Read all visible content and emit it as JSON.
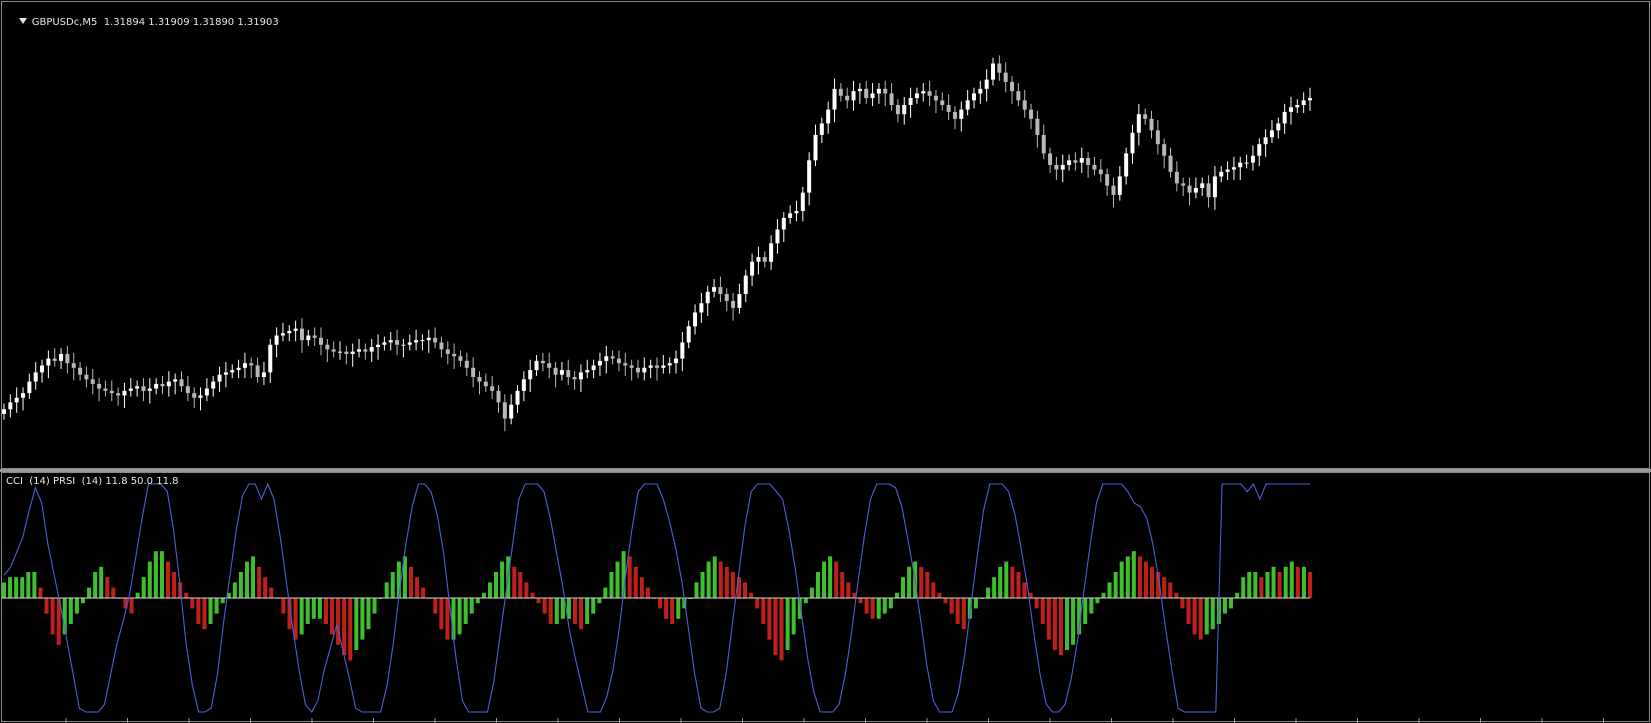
{
  "header": {
    "symbol_line": "GBPUSDc,M5  1.31894 1.31909 1.31890 1.31903",
    "indicator_line": "CCI  (14) PRSI  (14) 11.8 50.0 11.8"
  },
  "colors": {
    "background": "#000000",
    "bull_candle": "#ffffff",
    "bear_candle": "#b8b8b8",
    "cci_line": "#4d5fd6",
    "hist_up": "#3fbf2f",
    "hist_down": "#c0201a",
    "zero_line": "#d8d8d8"
  },
  "chart_data": [
    {
      "type": "candlestick",
      "title": "GBPUSDc,M5",
      "last_bar": {
        "open": 1.31894,
        "high": 1.31909,
        "low": 1.3189,
        "close": 1.31903
      },
      "ylim": [
        1.306,
        1.325
      ],
      "close_series": [
        1.3082,
        1.3085,
        1.3087,
        1.3089,
        1.3094,
        1.3098,
        1.3101,
        1.3104,
        1.3103,
        1.3106,
        1.3102,
        1.31,
        1.3097,
        1.3095,
        1.3093,
        1.3091,
        1.309,
        1.3089,
        1.3088,
        1.309,
        1.3091,
        1.3092,
        1.309,
        1.3091,
        1.3093,
        1.3092,
        1.3094,
        1.3095,
        1.3092,
        1.3089,
        1.3087,
        1.3088,
        1.3091,
        1.3094,
        1.3097,
        1.3098,
        1.3099,
        1.31,
        1.3102,
        1.3101,
        1.3096,
        1.3098,
        1.311,
        1.3114,
        1.3115,
        1.3116,
        1.3117,
        1.3112,
        1.3114,
        1.3113,
        1.311,
        1.3108,
        1.3107,
        1.3107,
        1.3106,
        1.3107,
        1.3108,
        1.3107,
        1.3109,
        1.311,
        1.3111,
        1.3112,
        1.311,
        1.311,
        1.3111,
        1.3112,
        1.3112,
        1.3113,
        1.3111,
        1.3108,
        1.3106,
        1.3105,
        1.3103,
        1.31,
        1.3096,
        1.3094,
        1.3092,
        1.309,
        1.3085,
        1.3078,
        1.3084,
        1.309,
        1.3095,
        1.3099,
        1.3103,
        1.3102,
        1.31,
        1.3097,
        1.3099,
        1.3096,
        1.3095,
        1.3098,
        1.3099,
        1.3101,
        1.3103,
        1.3105,
        1.3104,
        1.3102,
        1.3101,
        1.31,
        1.3098,
        1.31,
        1.3101,
        1.31,
        1.3101,
        1.3102,
        1.3104,
        1.3111,
        1.3118,
        1.3124,
        1.3128,
        1.3133,
        1.3135,
        1.3132,
        1.3129,
        1.3126,
        1.3132,
        1.314,
        1.3146,
        1.3148,
        1.3146,
        1.3154,
        1.316,
        1.3165,
        1.3167,
        1.3168,
        1.3176,
        1.319,
        1.3201,
        1.3206,
        1.3212,
        1.3221,
        1.3218,
        1.3216,
        1.322,
        1.3221,
        1.3217,
        1.3219,
        1.3221,
        1.3219,
        1.3214,
        1.321,
        1.3214,
        1.3217,
        1.3219,
        1.322,
        1.3218,
        1.3216,
        1.3214,
        1.3211,
        1.3208,
        1.3212,
        1.3216,
        1.3219,
        1.3221,
        1.3225,
        1.3232,
        1.3228,
        1.3224,
        1.322,
        1.3216,
        1.3212,
        1.3208,
        1.3201,
        1.3193,
        1.3188,
        1.3186,
        1.3188,
        1.319,
        1.3189,
        1.3191,
        1.3188,
        1.3186,
        1.3184,
        1.3179,
        1.3175,
        1.3183,
        1.3193,
        1.3202,
        1.321,
        1.3208,
        1.3203,
        1.3197,
        1.3192,
        1.3185,
        1.318,
        1.3179,
        1.3176,
        1.3178,
        1.318,
        1.3174,
        1.3183,
        1.3185,
        1.3186,
        1.3187,
        1.3189,
        1.3189,
        1.3192,
        1.3197,
        1.32,
        1.3203,
        1.3206,
        1.3211,
        1.3213,
        1.3214,
        1.3216,
        1.3217
      ]
    },
    {
      "type": "line+histogram",
      "title": "CCI (14) PRSI (14)",
      "values_shown": [
        11.8,
        50.0,
        11.8
      ],
      "ylim": [
        -300,
        300
      ],
      "cci_series": [
        60,
        80,
        120,
        160,
        230,
        290,
        250,
        140,
        60,
        -20,
        -110,
        -200,
        -290,
        -300,
        -300,
        -300,
        -280,
        -200,
        -120,
        -60,
        10,
        110,
        210,
        300,
        300,
        300,
        280,
        180,
        40,
        -120,
        -230,
        -300,
        -300,
        -290,
        -200,
        -60,
        60,
        180,
        270,
        300,
        300,
        260,
        300,
        260,
        160,
        40,
        -80,
        -190,
        -280,
        -300,
        -270,
        -190,
        -130,
        -70,
        -140,
        -210,
        -290,
        -300,
        -300,
        -300,
        -300,
        -230,
        -120,
        20,
        140,
        240,
        300,
        300,
        280,
        220,
        120,
        -20,
        -160,
        -270,
        -300,
        -300,
        -300,
        -300,
        -220,
        -100,
        20,
        140,
        260,
        300,
        300,
        300,
        280,
        210,
        120,
        30,
        -80,
        -160,
        -230,
        -300,
        -300,
        -300,
        -260,
        -190,
        -80,
        60,
        180,
        280,
        300,
        300,
        300,
        260,
        200,
        130,
        40,
        -80,
        -200,
        -290,
        -300,
        -300,
        -290,
        -200,
        -70,
        60,
        190,
        280,
        300,
        300,
        300,
        280,
        260,
        180,
        80,
        -40,
        -160,
        -250,
        -300,
        -300,
        -300,
        -280,
        -200,
        -90,
        40,
        160,
        260,
        300,
        300,
        300,
        290,
        240,
        150,
        60,
        -60,
        -180,
        -270,
        -300,
        -300,
        -300,
        -250,
        -150,
        -20,
        110,
        230,
        300,
        300,
        300,
        280,
        220,
        130,
        30,
        -90,
        -200,
        -280,
        -300,
        -300,
        -280,
        -210,
        -110,
        20,
        140,
        250,
        300,
        300,
        300,
        300,
        280,
        250,
        240,
        210,
        140,
        40,
        -80,
        -190,
        -290,
        -300,
        -300,
        -300,
        -300,
        -300,
        -300,
        300,
        300,
        300,
        300,
        280,
        300,
        260,
        300,
        300,
        300,
        300,
        300,
        300,
        300,
        300
      ],
      "prsi_histogram": [
        3,
        4,
        4,
        4,
        5,
        5,
        2,
        -3,
        -7,
        -9,
        -7,
        -5,
        -3,
        -1,
        2,
        5,
        6,
        4,
        2,
        0,
        -2,
        -3,
        1,
        4,
        7,
        9,
        9,
        7,
        5,
        3,
        1,
        -2,
        -5,
        -6,
        -5,
        -3,
        -1,
        1,
        3,
        5,
        7,
        8,
        6,
        4,
        2,
        0,
        -3,
        -6,
        -8,
        -7,
        -5,
        -4,
        -4,
        -5,
        -7,
        -9,
        -11,
        -12,
        -10,
        -8,
        -6,
        -3,
        0,
        3,
        5,
        7,
        8,
        6,
        4,
        2,
        0,
        -3,
        -6,
        -8,
        -8,
        -7,
        -5,
        -3,
        -1,
        1,
        3,
        5,
        7,
        8,
        6,
        5,
        3,
        1,
        -1,
        -3,
        -5,
        -5,
        -4,
        -4,
        -5,
        -6,
        -5,
        -3,
        -1,
        2,
        5,
        7,
        9,
        8,
        6,
        4,
        2,
        0,
        -2,
        -4,
        -5,
        -4,
        -2,
        0,
        3,
        5,
        7,
        8,
        7,
        6,
        5,
        4,
        3,
        1,
        -2,
        -5,
        -8,
        -11,
        -12,
        -10,
        -7,
        -4,
        -1,
        2,
        5,
        7,
        8,
        7,
        5,
        3,
        1,
        -1,
        -3,
        -4,
        -4,
        -3,
        -2,
        1,
        4,
        6,
        7,
        6,
        5,
        3,
        1,
        -1,
        -3,
        -5,
        -6,
        -4,
        -2,
        0,
        2,
        4,
        6,
        7,
        6,
        5,
        3,
        1,
        -2,
        -5,
        -8,
        -10,
        -11,
        -10,
        -9,
        -7,
        -5,
        -3,
        -1,
        1,
        3,
        5,
        7,
        8,
        9,
        8,
        7,
        6,
        5,
        4,
        3,
        1,
        -2,
        -5,
        -7,
        -8,
        -7,
        -6,
        -5,
        -3,
        -2,
        1,
        4,
        5,
        5,
        4,
        5,
        6,
        5,
        6,
        7,
        6,
        6,
        5
      ]
    }
  ]
}
